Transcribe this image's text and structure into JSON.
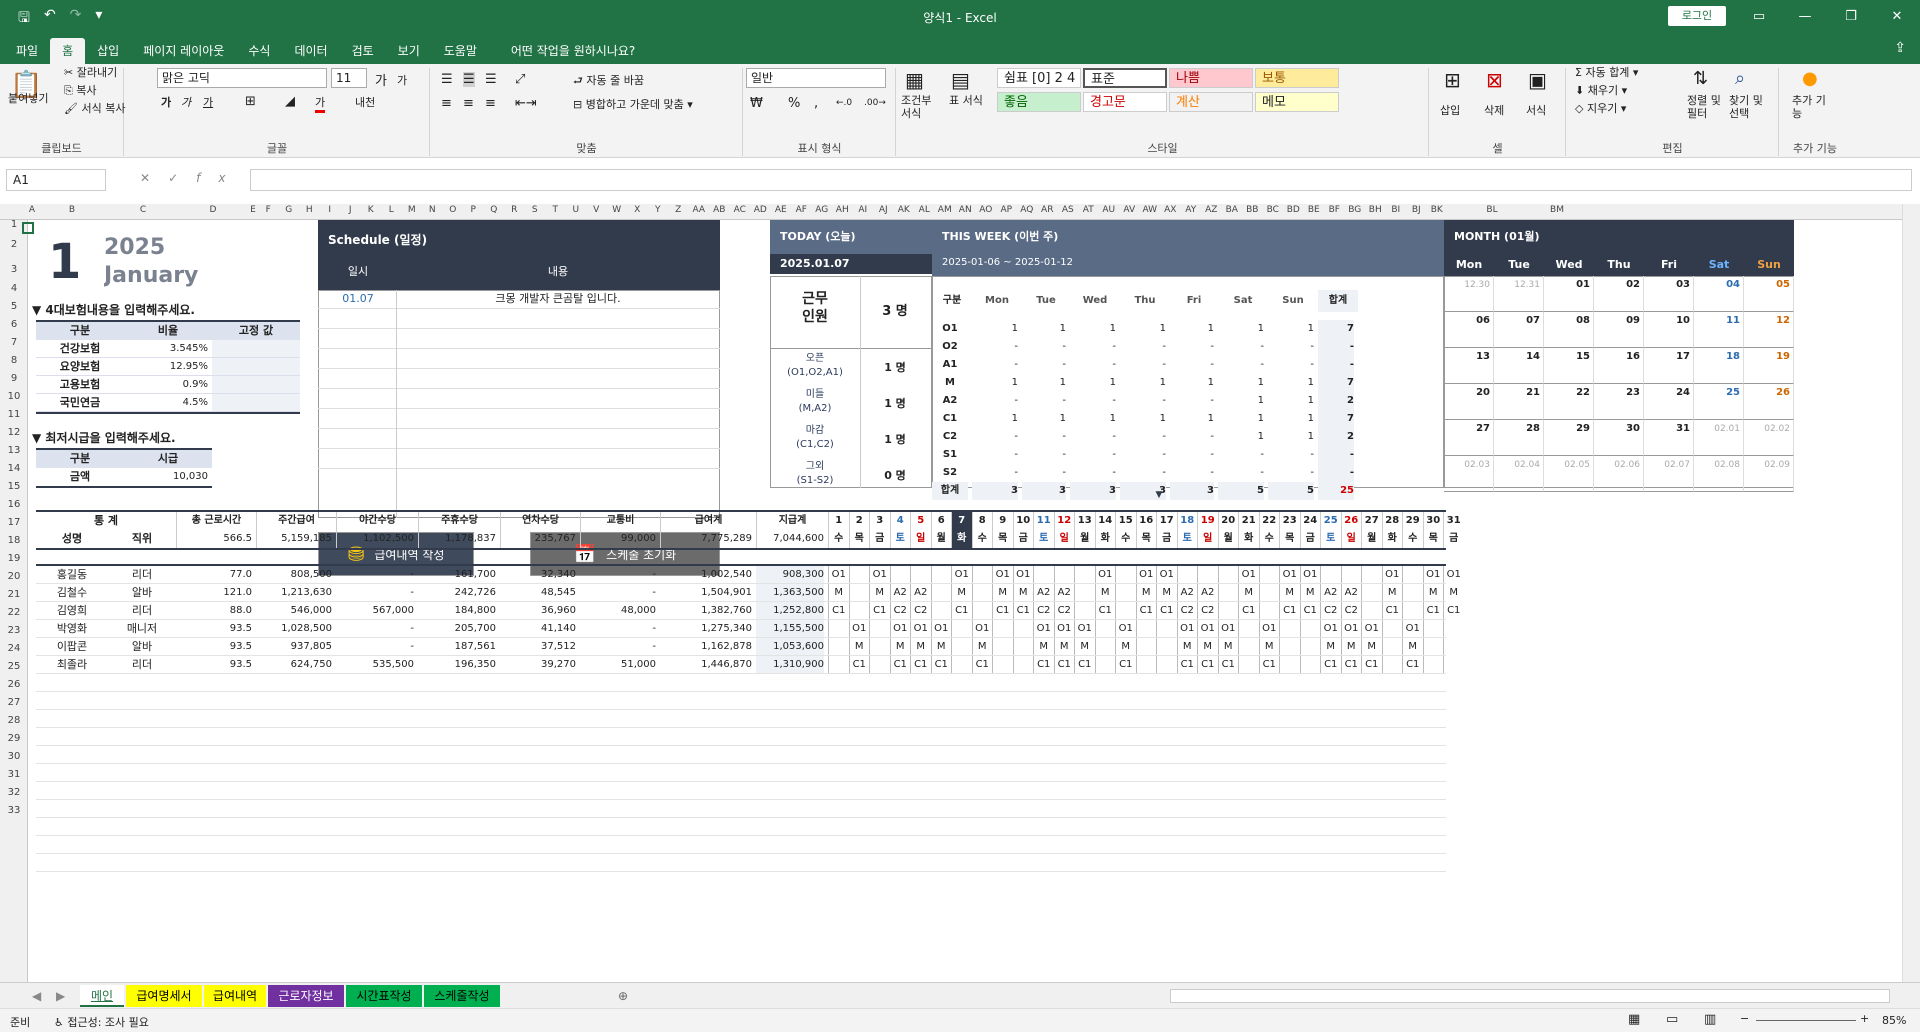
{
  "window": {
    "title": "양식1  -  Excel",
    "login": "로그인",
    "share_icon": "share-icon"
  },
  "tabs": [
    "파일",
    "홈",
    "삽입",
    "페이지 레이아웃",
    "수식",
    "데이터",
    "검토",
    "보기",
    "도움말",
    "어떤 작업을 원하시나요?"
  ],
  "ribbon": {
    "clipboard": {
      "paste": "붙여넣기",
      "cut": "잘라내기",
      "copy": "복사",
      "format_painter": "서식 복사",
      "label": "클립보드"
    },
    "font": {
      "name": "맑은 고딕",
      "size": "11",
      "label": "글꼴",
      "bold": "가",
      "italic": "가",
      "underline": "가",
      "grow": "가",
      "shrink": "가",
      "borders": "⊞",
      "fill": "◢",
      "color": "가",
      "phonetic": "내천"
    },
    "align": {
      "wrap": "자동 줄 바꿈",
      "merge": "병합하고 가운데 맞춤",
      "label": "맞춤"
    },
    "number": {
      "format": "일반",
      "label": "표시 형식",
      "currency": "₩",
      "percent": "%",
      "comma": ",",
      "inc_dec": "←.0",
      "dec_dec": ".00→"
    },
    "styles": {
      "cond": "조건부 서식",
      "table": "표 서식",
      "items": [
        "쉼표 [0] 2 4",
        "표준",
        "나쁨",
        "보통",
        "좋음",
        "경고문",
        "계산",
        "메모"
      ],
      "label": "스타일"
    },
    "cells": {
      "insert": "삽입",
      "delete": "삭제",
      "format": "서식",
      "label": "셀"
    },
    "edit": {
      "autosum": "자동 합계",
      "fill": "채우기",
      "clear": "지우기",
      "sort": "정렬 및 필터",
      "find": "찾기 및 선택",
      "label": "편집"
    },
    "addins": {
      "label": "추가 기능",
      "btn": "추가 기능"
    }
  },
  "formula": {
    "namebox": "A1"
  },
  "cols": [
    "A",
    "B",
    "C",
    "D",
    "E",
    "F",
    "G",
    "H",
    "I",
    "J",
    "K",
    "L",
    "M",
    "N",
    "O",
    "P",
    "Q",
    "R",
    "S",
    "T",
    "U",
    "V",
    "W",
    "X",
    "Y",
    "Z",
    "AA",
    "AB",
    "AC",
    "AD",
    "AE",
    "AF",
    "AG",
    "AH",
    "AI",
    "AJ",
    "AK",
    "AL",
    "AM",
    "AN",
    "AO",
    "AP",
    "AQ",
    "AR",
    "AS",
    "AT",
    "AU",
    "AV",
    "AW",
    "AX",
    "AY",
    "AZ",
    "BA",
    "BB",
    "BC",
    "BD",
    "BE",
    "BF",
    "BG",
    "BH",
    "BI",
    "BJ",
    "BK",
    "BL",
    "BM"
  ],
  "rows": [
    "1",
    "2",
    "3",
    "4",
    "5",
    "6",
    "7",
    "8",
    "9",
    "10",
    "11",
    "12",
    "13",
    "14",
    "15",
    "16",
    "17",
    "18",
    "19",
    "20",
    "21",
    "22",
    "23",
    "24",
    "25",
    "26",
    "27",
    "28",
    "29",
    "30",
    "31",
    "32",
    "33"
  ],
  "header": {
    "month_num": "1",
    "year": "2025",
    "month": "January"
  },
  "insurance": {
    "title": "▼ 4대보험내용을 입력해주세요.",
    "h": [
      "구분",
      "비율",
      "고정 값"
    ],
    "rows": [
      [
        "건강보험",
        "3.545%",
        ""
      ],
      [
        "요양보험",
        "12.95%",
        ""
      ],
      [
        "고용보험",
        "0.9%",
        ""
      ],
      [
        "국민연금",
        "4.5%",
        ""
      ]
    ]
  },
  "minwage": {
    "title": "▼ 최저시급을 입력해주세요.",
    "h": [
      "구분",
      "시급"
    ],
    "row": [
      "금액",
      "10,030"
    ]
  },
  "schedule": {
    "title": "Schedule (일정)",
    "h": [
      "일시",
      "내용"
    ],
    "first": [
      "01.07",
      "크몽 개발자 큰곰탈 입니다."
    ]
  },
  "buttons": {
    "payroll": "급여내역 작성",
    "reset": "스케줄 초기화"
  },
  "today": {
    "title": "TODAY (오늘)",
    "date": "2025.01.07",
    "staff_label": "근무\n인원",
    "staff_val": "3 명",
    "shifts": [
      [
        "오픈\n(O1,O2,A1)",
        "1 명"
      ],
      [
        "미들\n(M,A2)",
        "1 명"
      ],
      [
        "마감\n(C1,C2)",
        "1 명"
      ],
      [
        "그외\n(S1-S2)",
        "0 명"
      ]
    ]
  },
  "week": {
    "title": "THIS WEEK (이번 주)",
    "range": "2025-01-06 ~ 2025-01-12",
    "h": [
      "구분",
      "Mon",
      "Tue",
      "Wed",
      "Thu",
      "Fri",
      "Sat",
      "Sun",
      "합계"
    ],
    "rows": [
      [
        "O1",
        "1",
        "1",
        "1",
        "1",
        "1",
        "1",
        "1",
        "7"
      ],
      [
        "O2",
        "-",
        "-",
        "-",
        "-",
        "-",
        "-",
        "-",
        "-"
      ],
      [
        "A1",
        "-",
        "-",
        "-",
        "-",
        "-",
        "-",
        "-",
        "-"
      ],
      [
        "M",
        "1",
        "1",
        "1",
        "1",
        "1",
        "1",
        "1",
        "7"
      ],
      [
        "A2",
        "-",
        "-",
        "-",
        "-",
        "-",
        "1",
        "1",
        "2"
      ],
      [
        "C1",
        "1",
        "1",
        "1",
        "1",
        "1",
        "1",
        "1",
        "7"
      ],
      [
        "C2",
        "-",
        "-",
        "-",
        "-",
        "-",
        "1",
        "1",
        "2"
      ],
      [
        "S1",
        "-",
        "-",
        "-",
        "-",
        "-",
        "-",
        "-",
        "-"
      ],
      [
        "S2",
        "-",
        "-",
        "-",
        "-",
        "-",
        "-",
        "-",
        "-"
      ],
      [
        "합계",
        "3",
        "3",
        "3",
        "3",
        "3",
        "5",
        "5",
        "25"
      ]
    ]
  },
  "month": {
    "title": "MONTH (01월)",
    "h": [
      "Mon",
      "Tue",
      "Wed",
      "Thu",
      "Fri",
      "Sat",
      "Sun"
    ],
    "weeks": [
      [
        "12.30",
        "12.31",
        "01",
        "02",
        "03",
        "04",
        "05"
      ],
      [
        "06",
        "07",
        "08",
        "09",
        "10",
        "11",
        "12"
      ],
      [
        "13",
        "14",
        "15",
        "16",
        "17",
        "18",
        "19"
      ],
      [
        "20",
        "21",
        "22",
        "23",
        "24",
        "25",
        "26"
      ],
      [
        "27",
        "28",
        "29",
        "30",
        "31",
        "02.01",
        "02.02"
      ],
      [
        "02.03",
        "02.04",
        "02.05",
        "02.06",
        "02.07",
        "02.08",
        "02.09"
      ]
    ]
  },
  "stats": {
    "title": "통   계",
    "name_h": "성명",
    "pos_h": "직위",
    "cols": [
      "총 근로시간",
      "주간급여",
      "야간수당",
      "주휴수당",
      "연차수당",
      "교통비",
      "급여계",
      "지급계"
    ],
    "totals": [
      "566.5",
      "5,159,185",
      "1,102,500",
      "1,178,837",
      "235,767",
      "99,000",
      "7,775,289",
      "7,044,600"
    ],
    "days": [
      "1",
      "2",
      "3",
      "4",
      "5",
      "6",
      "7",
      "8",
      "9",
      "10",
      "11",
      "12",
      "13",
      "14",
      "15",
      "16",
      "17",
      "18",
      "19",
      "20",
      "21",
      "22",
      "23",
      "24",
      "25",
      "26",
      "27",
      "28",
      "29",
      "30",
      "31"
    ],
    "wd": [
      "수",
      "목",
      "금",
      "토",
      "일",
      "월",
      "화",
      "수",
      "목",
      "금",
      "토",
      "일",
      "월",
      "화",
      "수",
      "목",
      "금",
      "토",
      "일",
      "월",
      "화",
      "수",
      "목",
      "금",
      "토",
      "일",
      "월",
      "화",
      "수",
      "목",
      "금"
    ],
    "people": [
      {
        "name": "홍길동",
        "pos": "리더",
        "v": [
          "77.0",
          "808,500",
          "-",
          "161,700",
          "32,340",
          "-",
          "1,002,540",
          "908,300"
        ],
        "s": [
          "O1",
          "",
          "O1",
          "",
          "",
          "",
          "O1",
          "",
          "O1",
          "O1",
          "",
          "",
          "",
          "O1",
          "",
          "O1",
          "O1",
          "",
          "",
          "",
          "O1",
          "",
          "O1",
          "O1",
          "",
          "",
          "",
          "O1",
          "",
          "O1",
          "O1"
        ]
      },
      {
        "name": "김철수",
        "pos": "알바",
        "v": [
          "121.0",
          "1,213,630",
          "-",
          "242,726",
          "48,545",
          "-",
          "1,504,901",
          "1,363,500"
        ],
        "s": [
          "M",
          "",
          "M",
          "A2",
          "A2",
          "",
          "M",
          "",
          "M",
          "M",
          "A2",
          "A2",
          "",
          "M",
          "",
          "M",
          "M",
          "A2",
          "A2",
          "",
          "M",
          "",
          "M",
          "M",
          "A2",
          "A2",
          "",
          "M",
          "",
          "M",
          "M"
        ]
      },
      {
        "name": "김영희",
        "pos": "리더",
        "v": [
          "88.0",
          "546,000",
          "567,000",
          "184,800",
          "36,960",
          "48,000",
          "1,382,760",
          "1,252,800"
        ],
        "s": [
          "C1",
          "",
          "C1",
          "C2",
          "C2",
          "",
          "C1",
          "",
          "C1",
          "C1",
          "C2",
          "C2",
          "",
          "C1",
          "",
          "C1",
          "C1",
          "C2",
          "C2",
          "",
          "C1",
          "",
          "C1",
          "C1",
          "C2",
          "C2",
          "",
          "C1",
          "",
          "C1",
          "C1"
        ]
      },
      {
        "name": "박영화",
        "pos": "매니저",
        "v": [
          "93.5",
          "1,028,500",
          "-",
          "205,700",
          "41,140",
          "-",
          "1,275,340",
          "1,155,500"
        ],
        "s": [
          "",
          "O1",
          "",
          "O1",
          "O1",
          "O1",
          "",
          "O1",
          "",
          "",
          "O1",
          "O1",
          "O1",
          "",
          "O1",
          "",
          "",
          "O1",
          "O1",
          "O1",
          "",
          "O1",
          "",
          "",
          "O1",
          "O1",
          "O1",
          "",
          "O1",
          "",
          ""
        ]
      },
      {
        "name": "이팝콘",
        "pos": "알바",
        "v": [
          "93.5",
          "937,805",
          "-",
          "187,561",
          "37,512",
          "-",
          "1,162,878",
          "1,053,600"
        ],
        "s": [
          "",
          "M",
          "",
          "M",
          "M",
          "M",
          "",
          "M",
          "",
          "",
          "M",
          "M",
          "M",
          "",
          "M",
          "",
          "",
          "M",
          "M",
          "M",
          "",
          "M",
          "",
          "",
          "M",
          "M",
          "M",
          "",
          "M",
          "",
          ""
        ]
      },
      {
        "name": "최졸라",
        "pos": "리더",
        "v": [
          "93.5",
          "624,750",
          "535,500",
          "196,350",
          "39,270",
          "51,000",
          "1,446,870",
          "1,310,900"
        ],
        "s": [
          "",
          "C1",
          "",
          "C1",
          "C1",
          "C1",
          "",
          "C1",
          "",
          "",
          "C1",
          "C1",
          "C1",
          "",
          "C1",
          "",
          "",
          "C1",
          "C1",
          "C1",
          "",
          "C1",
          "",
          "",
          "C1",
          "C1",
          "C1",
          "",
          "C1",
          "",
          ""
        ]
      }
    ]
  },
  "sheets": [
    {
      "n": "메인",
      "bg": "#ffffff",
      "fg": "#217346"
    },
    {
      "n": "급여명세서",
      "bg": "#ffff00",
      "fg": "#000"
    },
    {
      "n": "급여내역",
      "bg": "#ffff00",
      "fg": "#000"
    },
    {
      "n": "근로자정보",
      "bg": "#7030a0",
      "fg": "#fff"
    },
    {
      "n": "시간표작성",
      "bg": "#00b050",
      "fg": "#000"
    },
    {
      "n": "스케줄작성",
      "bg": "#00b050",
      "fg": "#000"
    }
  ],
  "status": {
    "ready": "준비",
    "access": "접근성: 조사 필요",
    "zoom": "85%"
  }
}
